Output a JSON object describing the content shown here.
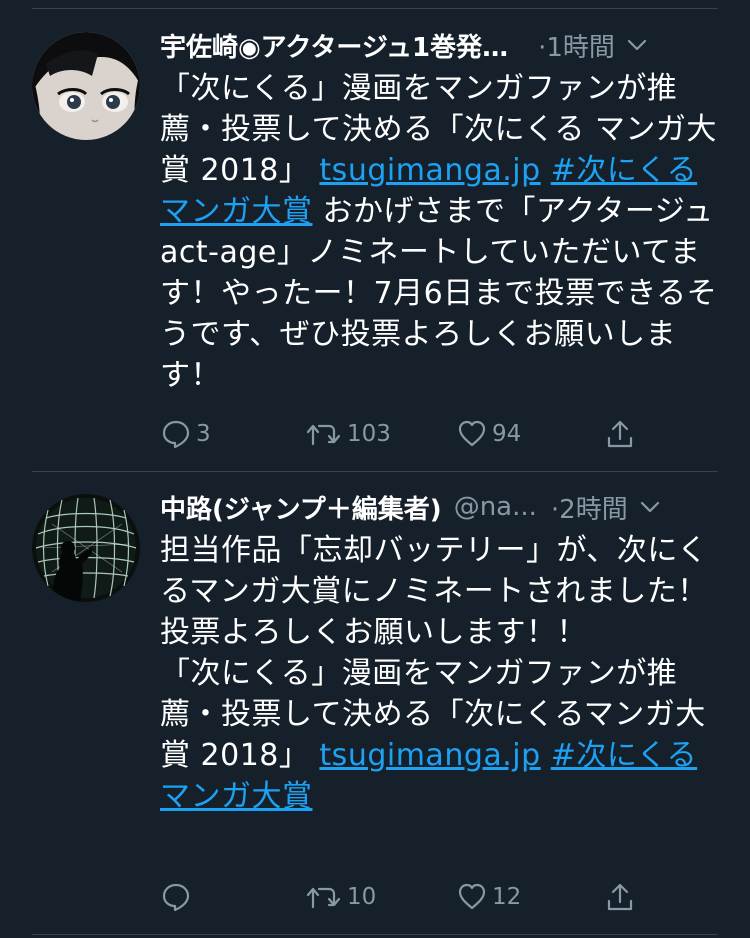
{
  "tweets": [
    {
      "name": "宇佐崎◉アクタージュ1巻発…",
      "handle": "",
      "time": "·1時間",
      "avatar_icon": "anime-girl-avatar",
      "text_before": "「次にくる」漫画をマンガファンが推薦・投票して決める「次にくる マンガ大賞 2018」 ",
      "link_url": "tsugimanga.jp",
      "link_hashtag": "#次にくるマンガ大賞",
      "text_after": " おかげさまで「アクタージュ act-age」ノミネートしていただいてます！やったー！7月6日まで投票できるそうです、ぜひ投票よろしくお願いします！",
      "reply_count": "3",
      "retweet_count": "103",
      "like_count": "94"
    },
    {
      "name": "中路(ジャンプ＋編集者)",
      "handle": "@na...",
      "time": "·2時間",
      "avatar_icon": "light-sphere-avatar",
      "text_before": "担当作品「忘却バッテリー」が、次にくるマンガ大賞にノミネートされました！\n投票よろしくお願いします！！\n「次にくる」漫画をマンガファンが推薦・投票して決める「次にくるマンガ大賞 2018」 ",
      "link_url": "tsugimanga.jp",
      "link_hashtag": "#次にくるマンガ大賞",
      "text_after": "",
      "reply_count": "",
      "retweet_count": "10",
      "like_count": "12"
    }
  ],
  "colors": {
    "background": "#15202b",
    "text": "#ffffff",
    "secondary": "#8899a6",
    "link": "#1da1f2",
    "divider": "#38444d"
  }
}
